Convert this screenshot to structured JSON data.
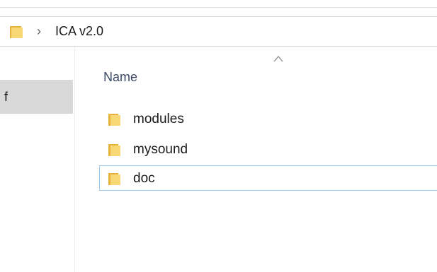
{
  "address_bar": {
    "folder_icon": "folder-icon",
    "separator_icon": "chevron-right-icon",
    "current_folder": "ICA v2.0"
  },
  "nav_pane": {
    "selected_item_label": "f"
  },
  "file_list": {
    "sort_indicator_icon": "sort-ascending-icon",
    "name_column_header": "Name",
    "items": [
      {
        "name": "modules",
        "icon": "folder-icon"
      },
      {
        "name": "mysound",
        "icon": "folder-icon"
      },
      {
        "name": "doc",
        "icon": "folder-icon",
        "focused": true
      }
    ]
  },
  "colors": {
    "folder_yellow": "#f8d775",
    "folder_dark": "#e8b33d",
    "nav_selected_bg": "#d9d9d9",
    "focus_border": "#99c9ef",
    "header_text": "#3c4a66"
  }
}
